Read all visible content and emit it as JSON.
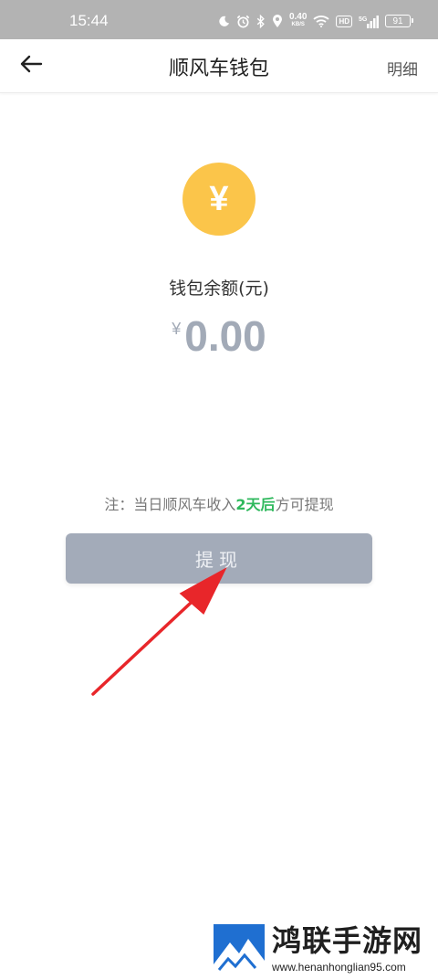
{
  "status_bar": {
    "time": "15:44",
    "net_speed_value": "0.40",
    "net_speed_unit": "KB/S",
    "hd_badge": "HD",
    "battery_level": "91",
    "icons": [
      "moon-icon",
      "alarm-icon",
      "bluetooth-icon",
      "location-icon",
      "wifi-icon",
      "hd-icon",
      "signal-5g-icon",
      "battery-icon"
    ]
  },
  "nav": {
    "back_icon": "arrow-left-icon",
    "title": "顺风车钱包",
    "detail_label": "明细"
  },
  "wallet": {
    "coin_symbol": "¥",
    "balance_label": "钱包余额(元)",
    "currency_symbol": "¥",
    "balance": "0.00"
  },
  "note": {
    "prefix": "注：当日顺风车收入",
    "highlight": "2天后",
    "suffix": "方可提现"
  },
  "withdraw_button_label": "提现",
  "watermark": {
    "brand": "鸿联手游网",
    "url": "www.henanhonglian95.com"
  },
  "colors": {
    "status_bar_bg": "#b3b3b3",
    "coin": "#fbc54a",
    "balance_text": "#a2aab7",
    "highlight_green": "#2eb85c",
    "button_bg": "#a3abb9",
    "annotation_arrow": "#e8262a"
  }
}
